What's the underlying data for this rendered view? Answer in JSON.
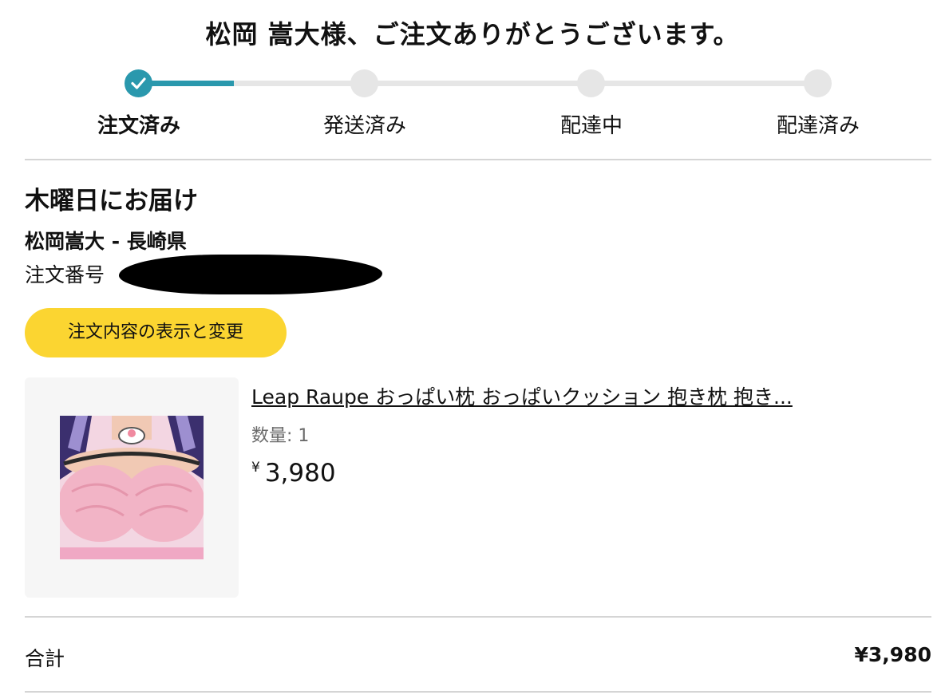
{
  "header": {
    "title": "松岡 嵩大様、ご注文ありがとうございます。"
  },
  "tracker": {
    "steps": [
      {
        "label": "注文済み",
        "state": "complete"
      },
      {
        "label": "発送済み",
        "state": "pending"
      },
      {
        "label": "配達中",
        "state": "pending"
      },
      {
        "label": "配達済み",
        "state": "pending"
      }
    ],
    "progress_fraction": 0.14,
    "accent_color": "#2a98ad",
    "inactive_color": "#e6e6e6"
  },
  "delivery": {
    "title": "木曜日にお届け",
    "recipient": "松岡嵩大 - 長崎県",
    "order_number_label": "注文番号"
  },
  "actions": {
    "view_edit_label": "注文内容の表示と変更",
    "button_color": "#fbd531"
  },
  "item": {
    "title": "Leap Raupe おっぱい枕 おっぱいクッション 抱き枕 抱き...",
    "quantity": "数量: 1",
    "currency_symbol": "¥",
    "price": "3,980"
  },
  "summary": {
    "total_label": "合計",
    "total_value": "¥3,980"
  }
}
